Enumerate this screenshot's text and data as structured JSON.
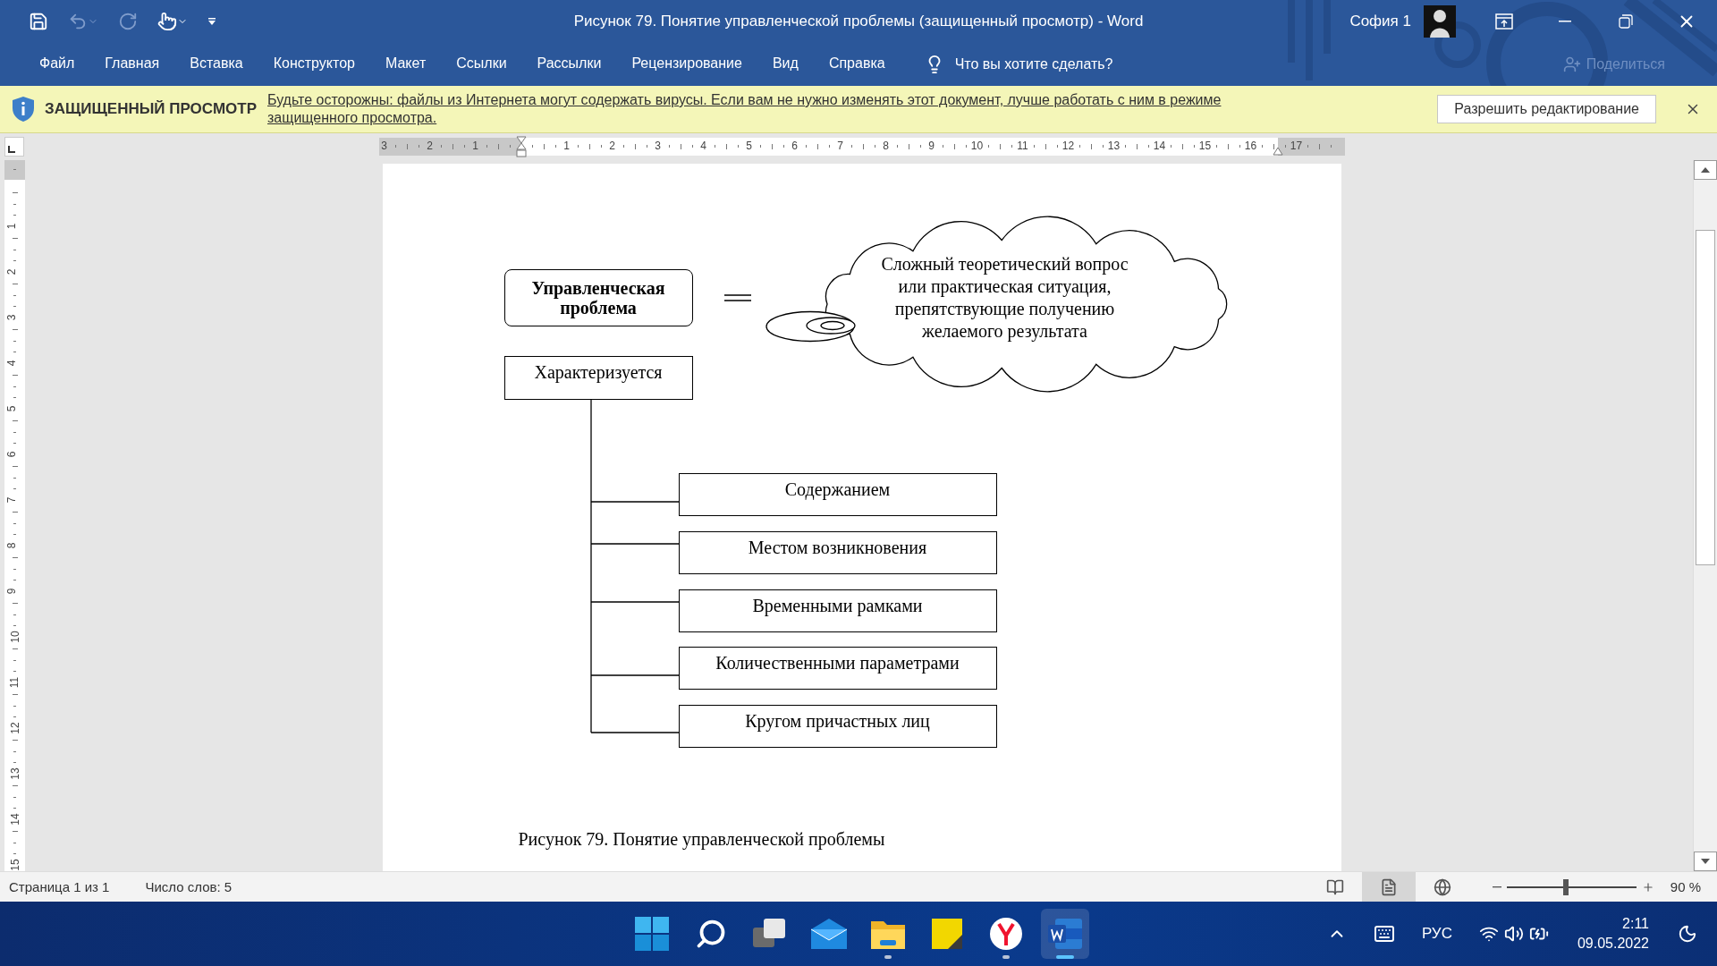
{
  "window": {
    "title": "Рисунок 79. Понятие управленческой проблемы (защищенный просмотр)  -  Word",
    "user": "София 1"
  },
  "ribbon_tabs": [
    {
      "label": "Файл",
      "selected": false
    },
    {
      "label": "Главная",
      "selected": false
    },
    {
      "label": "Вставка",
      "selected": false
    },
    {
      "label": "Конструктор",
      "selected": false
    },
    {
      "label": "Макет",
      "selected": false
    },
    {
      "label": "Ссылки",
      "selected": false
    },
    {
      "label": "Рассылки",
      "selected": false
    },
    {
      "label": "Рецензирование",
      "selected": false
    },
    {
      "label": "Вид",
      "selected": false
    },
    {
      "label": "Справка",
      "selected": false
    }
  ],
  "tell_me": {
    "placeholder": "Что вы хотите сделать?"
  },
  "share": {
    "label": "Поделиться",
    "disabled": true
  },
  "protected_bar": {
    "title": "ЗАЩИЩЕННЫЙ ПРОСМОТР",
    "message_lines": [
      "Будьте осторожны: файлы из Интернета могут содержать вирусы. Если вам не нужно изменять этот документ, лучше работать с ним в режиме",
      "защищенного просмотра."
    ],
    "button": "Разрешить редактирование"
  },
  "ruler": {
    "left_margin_marks": [
      "3",
      "2",
      "1"
    ],
    "marks": [
      "1",
      "2",
      "3",
      "4",
      "5",
      "6",
      "7",
      "8",
      "9",
      "10",
      "11",
      "12",
      "13",
      "14",
      "15",
      "16",
      "17"
    ],
    "vertical_marks": [
      "1",
      "2",
      "3",
      "4",
      "5",
      "6",
      "7",
      "8",
      "9",
      "10",
      "11",
      "12",
      "13",
      "14",
      "15"
    ]
  },
  "diagram": {
    "concept": "Управленческая проблема",
    "definition_lines": [
      "Сложный теоретический вопрос",
      "или практическая ситуация,",
      "препятствующие получению",
      "желаемого результата"
    ],
    "root": "Характеризуется",
    "branches": [
      "Содержанием",
      "Местом возникновения",
      "Временными рамками",
      "Количественными параметрами",
      "Кругом причастных лиц"
    ]
  },
  "caption": "Рисунок 79. Понятие управленческой проблемы",
  "status_bar": {
    "page": "Страница 1 из 1",
    "words": "Число слов: 5",
    "zoom": "90 %",
    "zoom_slider": {
      "level": 0.46
    },
    "views": [
      {
        "kind": "read",
        "selected": false
      },
      {
        "kind": "print",
        "selected": true
      },
      {
        "kind": "web",
        "selected": false
      }
    ]
  },
  "taskbar": {
    "apps": [
      {
        "kind": "start",
        "open": false,
        "active": false
      },
      {
        "kind": "search",
        "open": false,
        "active": false
      },
      {
        "kind": "taskview",
        "open": false,
        "active": false
      },
      {
        "kind": "mail",
        "open": false,
        "active": false
      },
      {
        "kind": "explorer",
        "open": true,
        "active": false
      },
      {
        "kind": "notes",
        "open": false,
        "active": false
      },
      {
        "kind": "browser",
        "open": true,
        "active": false
      },
      {
        "kind": "word",
        "open": true,
        "active": true
      }
    ],
    "language": "РУС",
    "time": "2:11",
    "date": "09.05.2022"
  }
}
